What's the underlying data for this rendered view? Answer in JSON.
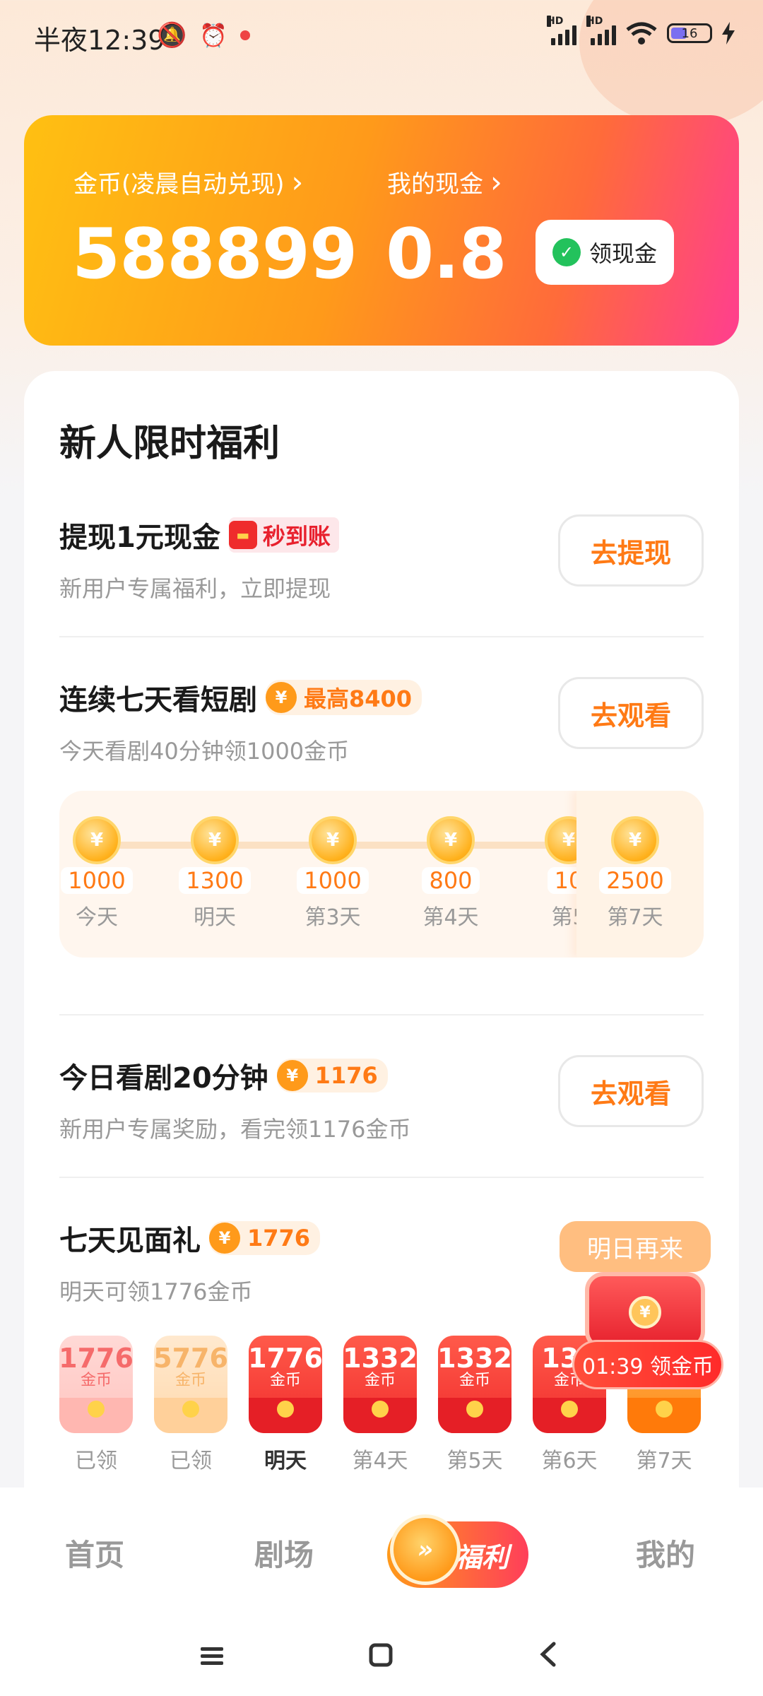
{
  "status_bar": {
    "time": "半夜12:39",
    "battery": "16"
  },
  "coin_card": {
    "coins_label": "金币(凌晨自动兑现)",
    "coins_value": "588899",
    "cash_label": "我的现金",
    "cash_value": "0.8",
    "claim_cash_button": "领现金",
    "chevron": "›"
  },
  "section_title": "新人限时福利",
  "tasks": [
    {
      "title": "提现1元现金",
      "tag": "秒到账",
      "desc": "新用户专属福利，立即提现",
      "button": "去提现"
    },
    {
      "title": "连续七天看短剧",
      "tag": "最高8400",
      "desc": "今天看剧40分钟领1000金币",
      "button": "去观看"
    },
    {
      "title": "今日看剧20分钟",
      "tag": "1176",
      "desc": "新用户专属奖励，看完领1176金币",
      "button": "去观看"
    },
    {
      "title": "七天见面礼",
      "tag": "1776",
      "desc": "明天可领1776金币",
      "button": "明日再来"
    }
  ],
  "streak": [
    {
      "amount": "1000",
      "day": "今天"
    },
    {
      "amount": "1300",
      "day": "明天"
    },
    {
      "amount": "1000",
      "day": "第3天"
    },
    {
      "amount": "800",
      "day": "第4天"
    },
    {
      "amount": "10",
      "day": "第5"
    },
    {
      "amount": "2500",
      "day": "第7天"
    }
  ],
  "gifts": [
    {
      "amount": "1776",
      "unit": "金币",
      "day": "已领",
      "state": "claimed"
    },
    {
      "amount": "5776",
      "unit": "金币",
      "day": "已领",
      "state": "claimed"
    },
    {
      "amount": "1776",
      "unit": "金币",
      "day": "明天",
      "state": "next"
    },
    {
      "amount": "1332",
      "unit": "金币",
      "day": "第4天",
      "state": "locked"
    },
    {
      "amount": "1332",
      "unit": "金币",
      "day": "第5天",
      "state": "locked"
    },
    {
      "amount": "133",
      "unit": "金币",
      "day": "第6天",
      "state": "locked"
    },
    {
      "amount": "",
      "unit": "",
      "day": "第7天",
      "state": "locked"
    }
  ],
  "floating_chest": {
    "label": "01:39 领金币"
  },
  "bottom_nav": {
    "home": "首页",
    "theater": "剧场",
    "welfare": "福利",
    "mine": "我的"
  },
  "icons": {
    "coin_symbol": "¥"
  },
  "colors": {
    "accent": "#ff7a15",
    "red": "#e8212e"
  }
}
